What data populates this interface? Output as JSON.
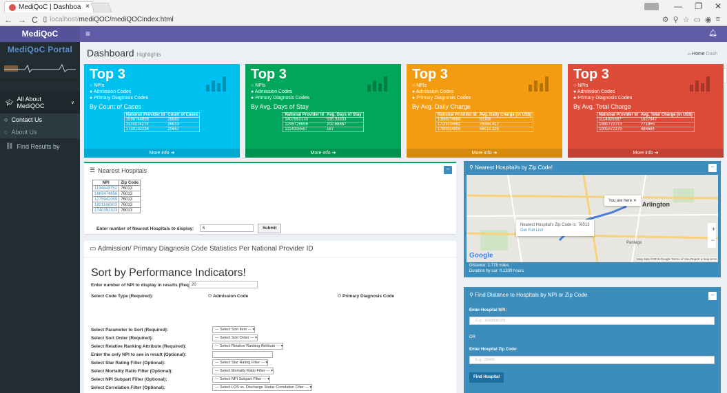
{
  "browser": {
    "tab_title": "MediQoC | Dashboa",
    "url_gray": "localhost/",
    "url_main": "mediQOC/mediQOCindex.html"
  },
  "header": {
    "logo": "MediQoC",
    "brand_color": "#605ca8"
  },
  "sidebar": {
    "portal_title": "MediQoC Portal",
    "items": [
      {
        "label": "All About MediQOC"
      },
      {
        "label": "Contact Us"
      },
      {
        "label": "About Us"
      },
      {
        "label": "Find Results by"
      }
    ]
  },
  "page": {
    "title": "Dashboard",
    "subtitle": "Highlights",
    "breadcrumb_home": "Home",
    "breadcrumb_current": "Dash"
  },
  "stat_boxes": [
    {
      "color": "#00c0ef",
      "heading": "Top 3",
      "lines": [
        "NPIs",
        "Admission Codes",
        "Primary Diagnosis Codes"
      ],
      "by": "By Count of Cases",
      "col1": "National Provider Id",
      "col2": "Count of Cases",
      "rows": [
        [
          "1598744856",
          "26992"
        ],
        [
          "1124074273",
          "26913"
        ],
        [
          "1730132234",
          "20657"
        ]
      ],
      "more": "More info"
    },
    {
      "color": "#00a65a",
      "heading": "Top 3",
      "lines": [
        "NPIs",
        "Admission Codes",
        "Primary Diagnosis Codes"
      ],
      "by": "By Avg. Days of Stay",
      "col1": "National Provider Id",
      "col2": "Avg. Days of Stay",
      "rows": [
        [
          "1407862170",
          "535.33333"
        ],
        [
          "1295726556",
          "202.66667"
        ],
        [
          "1114925567",
          "187"
        ]
      ],
      "more": "More info"
    },
    {
      "color": "#f39c12",
      "heading": "Top 3",
      "lines": [
        "NPIs",
        "Admission Codes",
        "Primary Diagnosis Codes"
      ],
      "by": "By Avg. Daily Charge",
      "col1": "National Provider Id",
      "col2": "Avg. Daily Charge (in US$)",
      "rows": [
        [
          "1356574669",
          "82308"
        ],
        [
          "1720078982",
          "76058.417"
        ],
        [
          "1780914805",
          "58518.326"
        ]
      ],
      "more": "More info"
    },
    {
      "color": "#dd4b39",
      "heading": "Top 3",
      "lines": [
        "NPIs",
        "Admission Codes",
        "Primary Diagnosis Codes"
      ],
      "by": "By Avg. Total Charge",
      "col1": "National Provider Id",
      "col2": "Avg. Total Charge (in US$)",
      "rows": [
        [
          "1114925567",
          "1627947"
        ],
        [
          "1881772713",
          "771855"
        ],
        [
          "1801872379",
          "486684"
        ]
      ],
      "more": "More info"
    }
  ],
  "nearest": {
    "title": "Nearest Hospitals",
    "col1": "NPI",
    "col2": "Zip Code",
    "rows": [
      [
        "1194849752",
        "76013"
      ],
      [
        "1669474656",
        "76013"
      ],
      [
        "1275942009",
        "76013"
      ],
      [
        "1821168303",
        "76013"
      ],
      [
        "1740392323",
        "76013"
      ]
    ],
    "label": "Enter number of Nearest Hospitals to display:",
    "value": "5",
    "submit": "Submit"
  },
  "stats": {
    "title": "Admission/ Primary Diagnosis Code Statistics Per National Provider ID",
    "heading": "Sort by Performance Indicators!",
    "npi_count_label": "Enter number of NPI to display in results (Required):",
    "npi_count_value": "20",
    "code_type_label": "Select Code Type (Required):",
    "radio1": "Admission Code",
    "radio2": "Primary Diagnosis Code",
    "fields": [
      {
        "label": "Select Parameter to Sort (Required):",
        "select": "--- Select Sort Item ---"
      },
      {
        "label": "Select Sort Order (Required):",
        "select": "--- Select Sort Order ---"
      },
      {
        "label": "Select Relative Ranking Attribute (Required):",
        "select": "--- Select Relative Ranking Attribute ---"
      },
      {
        "label": "Enter the only NPI to see in result (Optional):",
        "select": ""
      },
      {
        "label": "Select Star Rating Filter (Optional):",
        "select": "--- Select Star Rating Filter ---"
      },
      {
        "label": "Select Mortality Ratio Filter (Optional):",
        "select": "--- Select Mortality Ratio Filter ---"
      },
      {
        "label": "Select NPI Subpart Filter (Optional):",
        "select": "--- Select NPI Subpart Filter ---"
      },
      {
        "label": "Select Correlation Filter (Optional):",
        "select": "--- Select LOS vs. Discharge Status Correlation Filter ---"
      }
    ]
  },
  "map": {
    "title": "Nearest Hospital/s by Zip Code!",
    "city": "Arlington",
    "you_are_here": "You are here",
    "popup": "Nearest Hospital's Zip Code is: 76013",
    "popup_link": "Get Full List!",
    "town2": "Pantego",
    "google": "Google",
    "attribution": "Map data ©2016 Google   Terms of Use   Report a map error",
    "distance": "Distance: 2.778 miles",
    "duration": "Duration by car: 0.1339 hours"
  },
  "distance": {
    "title": "Find Distance to Hospitals by NPI or Zip Code",
    "npi_label": "Enter Hospital NPI:",
    "npi_placeholder": "E.g.: 1093000158",
    "or": "OR",
    "zip_label": "Enter Hospital Zip Code:",
    "zip_placeholder": "E.g.: 29495",
    "button": "Find Hospital"
  }
}
